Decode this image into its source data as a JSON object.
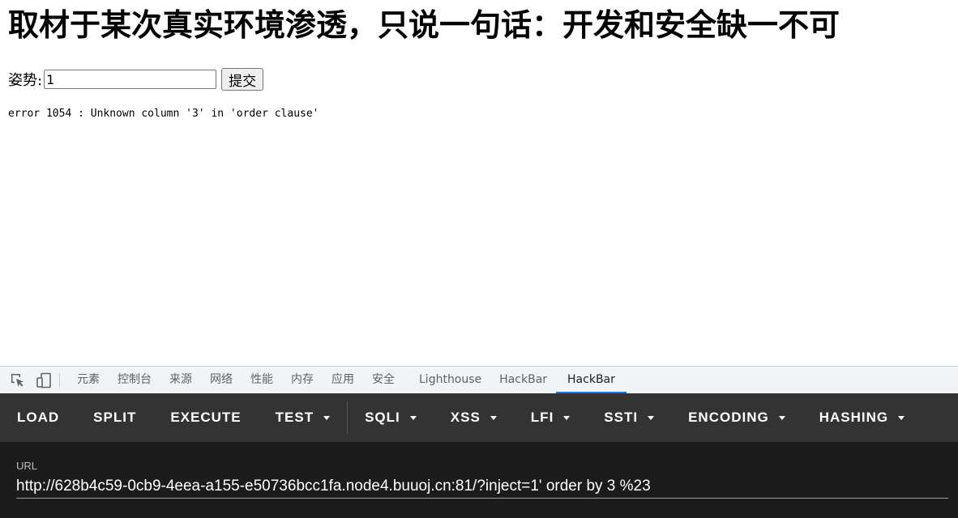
{
  "page": {
    "title": "取材于某次真实环境渗透，只说一句话：开发和安全缺一不可",
    "form": {
      "label": "姿势:",
      "input_value": "1",
      "submit_label": "提交"
    },
    "error_message": "error 1054 : Unknown column '3' in 'order clause'"
  },
  "devtools": {
    "icons": [
      "inspect-element-icon",
      "device-toolbar-icon"
    ],
    "tabs": [
      {
        "label": "元素"
      },
      {
        "label": "控制台"
      },
      {
        "label": "来源"
      },
      {
        "label": "网络"
      },
      {
        "label": "性能"
      },
      {
        "label": "内存"
      },
      {
        "label": "应用"
      },
      {
        "label": "安全"
      },
      {
        "label": "Lighthouse"
      },
      {
        "label": "HackBar"
      },
      {
        "label": "HackBar",
        "active": true
      }
    ]
  },
  "hackbar": {
    "buttons": [
      {
        "label": "LOAD"
      },
      {
        "label": "SPLIT"
      },
      {
        "label": "EXECUTE"
      },
      {
        "label": "TEST",
        "dropdown": true
      },
      {
        "label": "SQLI",
        "dropdown": true
      },
      {
        "label": "XSS",
        "dropdown": true
      },
      {
        "label": "LFI",
        "dropdown": true
      },
      {
        "label": "SSTI",
        "dropdown": true
      },
      {
        "label": "ENCODING",
        "dropdown": true
      },
      {
        "label": "HASHING",
        "dropdown": true
      }
    ],
    "url_label": "URL",
    "url_value": "http://628b4c59-0cb9-4eea-a155-e50736bcc1fa.node4.buuoj.cn:81/?inject=1' order by 3 %23"
  },
  "colors": {
    "toolbar_bg": "#333333",
    "url_bg": "#1c1c1c",
    "active_tab_accent": "#1a73e8",
    "devtools_bar_bg": "#f1f3f4"
  }
}
